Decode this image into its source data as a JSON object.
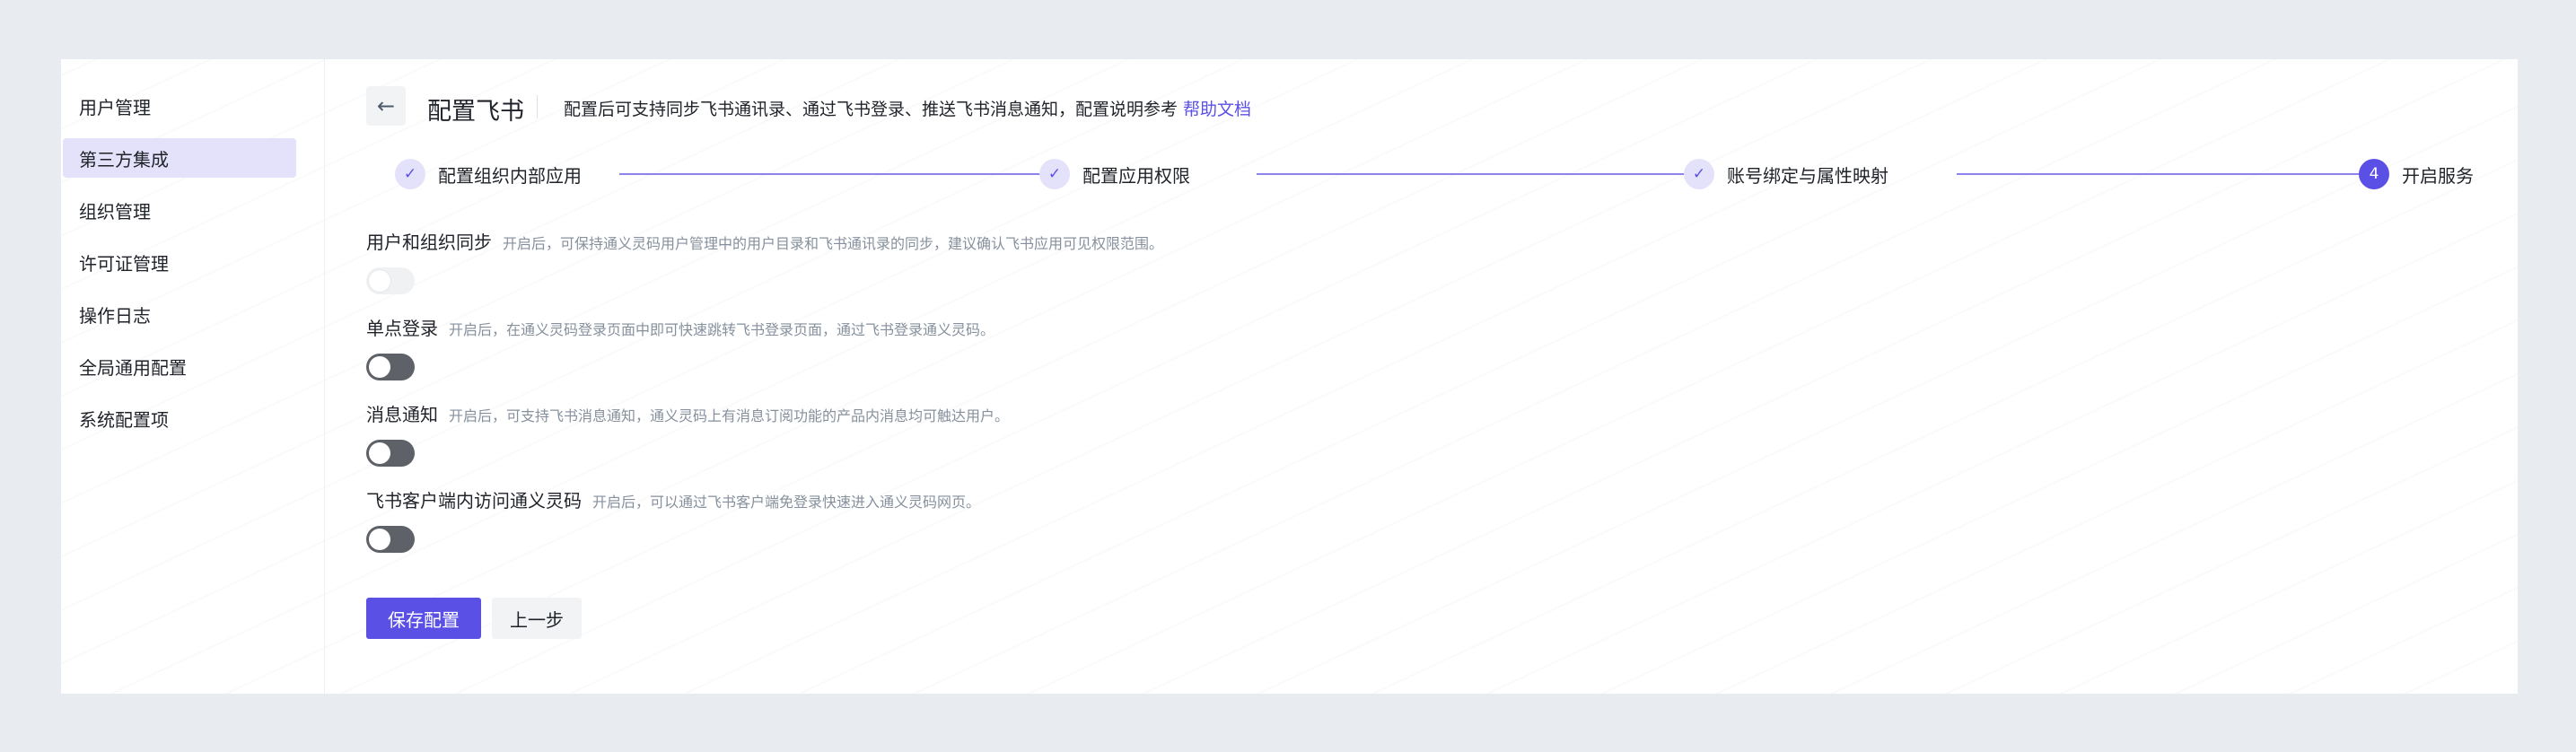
{
  "sidebar": {
    "items": [
      {
        "label": "用户管理",
        "active": false
      },
      {
        "label": "第三方集成",
        "active": true
      },
      {
        "label": "组织管理",
        "active": false
      },
      {
        "label": "许可证管理",
        "active": false
      },
      {
        "label": "操作日志",
        "active": false
      },
      {
        "label": "全局通用配置",
        "active": false
      },
      {
        "label": "系统配置项",
        "active": false
      }
    ]
  },
  "header": {
    "back_icon": "arrow-left-icon",
    "title": "配置飞书",
    "description": "配置后可支持同步飞书通讯录、通过飞书登录、推送飞书消息通知，配置说明参考",
    "help_link": "帮助文档"
  },
  "steps": [
    {
      "label": "配置组织内部应用",
      "status": "done",
      "icon": "check-icon"
    },
    {
      "label": "配置应用权限",
      "status": "done",
      "icon": "check-icon"
    },
    {
      "label": "账号绑定与属性映射",
      "status": "done",
      "icon": "check-icon"
    },
    {
      "label": "开启服务",
      "status": "current",
      "number": "4"
    }
  ],
  "settings": [
    {
      "title": "用户和组织同步",
      "hint": "开启后，可保持通义灵码用户管理中的用户目录和飞书通讯录的同步，建议确认飞书应用可见权限范围。",
      "enabled": false,
      "disabled": true
    },
    {
      "title": "单点登录",
      "hint": "开启后，在通义灵码登录页面中即可快速跳转飞书登录页面，通过飞书登录通义灵码。",
      "enabled": false,
      "disabled": false
    },
    {
      "title": "消息通知",
      "hint": "开启后，可支持飞书消息通知，通义灵码上有消息订阅功能的产品内消息均可触达用户。",
      "enabled": false,
      "disabled": false
    },
    {
      "title": "飞书客户端内访问通义灵码",
      "hint": "开启后，可以通过飞书客户端免登录快速进入通义灵码网页。",
      "enabled": false,
      "disabled": false
    }
  ],
  "actions": {
    "save_label": "保存配置",
    "prev_label": "上一步"
  },
  "colors": {
    "accent": "#5b50e6",
    "accent_light": "#e4e2fb",
    "page_bg": "#e8ebef",
    "toggle_off": "#5e6168"
  }
}
